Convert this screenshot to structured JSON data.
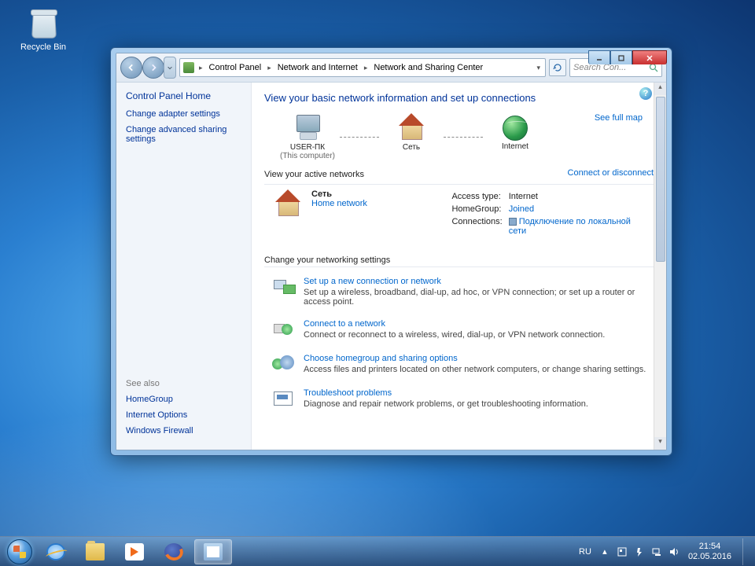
{
  "desktop": {
    "recycle_bin": "Recycle Bin"
  },
  "window": {
    "breadcrumb": {
      "root_icon": "control-panel",
      "seg1": "Control Panel",
      "seg2": "Network and Internet",
      "seg3": "Network and Sharing Center"
    },
    "search_placeholder": "Search Con...",
    "sidebar": {
      "home": "Control Panel Home",
      "links": [
        "Change adapter settings",
        "Change advanced sharing settings"
      ],
      "see_also_title": "See also",
      "see_also": [
        "HomeGroup",
        "Internet Options",
        "Windows Firewall"
      ]
    },
    "content": {
      "heading": "View your basic network information and set up connections",
      "see_full_map": "See full map",
      "nodes": {
        "computer_name": "USER-ПК",
        "computer_sub": "(This computer)",
        "network_name": "Сеть",
        "internet": "Internet"
      },
      "view_active": "View your active networks",
      "connect_disconnect": "Connect or disconnect",
      "active_network": {
        "name": "Сеть",
        "type": "Home network",
        "access_label": "Access type:",
        "access_value": "Internet",
        "homegroup_label": "HomeGroup:",
        "homegroup_value": "Joined",
        "connections_label": "Connections:",
        "connections_value": "Подключение по локальной сети"
      },
      "change_settings": "Change your networking settings",
      "tasks": [
        {
          "title": "Set up a new connection or network",
          "desc": "Set up a wireless, broadband, dial-up, ad hoc, or VPN connection; or set up a router or access point."
        },
        {
          "title": "Connect to a network",
          "desc": "Connect or reconnect to a wireless, wired, dial-up, or VPN network connection."
        },
        {
          "title": "Choose homegroup and sharing options",
          "desc": "Access files and printers located on other network computers, or change sharing settings."
        },
        {
          "title": "Troubleshoot problems",
          "desc": "Diagnose and repair network problems, or get troubleshooting information."
        }
      ]
    }
  },
  "taskbar": {
    "lang": "RU",
    "time": "21:54",
    "date": "02.05.2016"
  }
}
